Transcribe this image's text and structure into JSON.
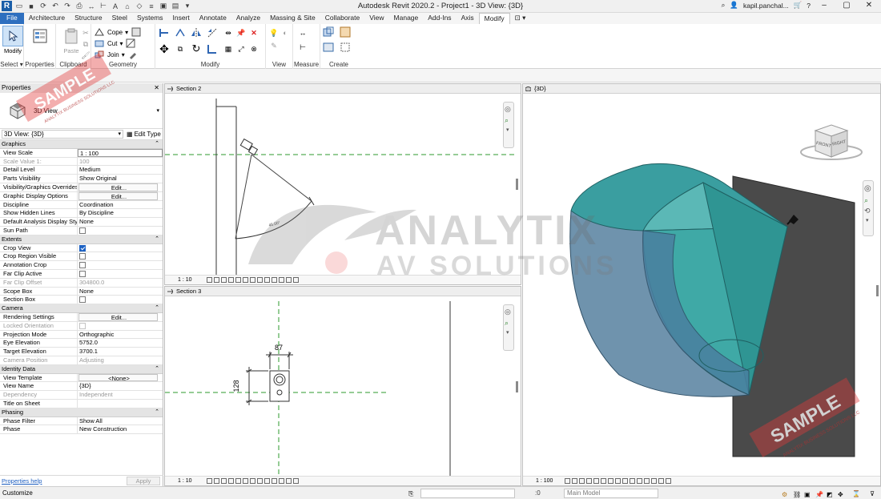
{
  "app": {
    "title": "Autodesk Revit 2020.2 - Project1 - 3D View: {3D}",
    "user": "kapil.panchal...",
    "logo_letter": "R"
  },
  "tabs": [
    {
      "label": "File"
    },
    {
      "label": "Architecture"
    },
    {
      "label": "Structure"
    },
    {
      "label": "Steel"
    },
    {
      "label": "Systems"
    },
    {
      "label": "Insert"
    },
    {
      "label": "Annotate"
    },
    {
      "label": "Analyze"
    },
    {
      "label": "Massing & Site"
    },
    {
      "label": "Collaborate"
    },
    {
      "label": "View"
    },
    {
      "label": "Manage"
    },
    {
      "label": "Add-Ins"
    },
    {
      "label": "Axis"
    },
    {
      "label": "Modify"
    }
  ],
  "ribbon": {
    "select": {
      "modify_label": "Modify",
      "panel_label": "Select"
    },
    "properties": {
      "panel_label": "Properties"
    },
    "clipboard": {
      "paste_label": "Paste",
      "panel_label": "Clipboard"
    },
    "geometry": {
      "cope_label": "Cope",
      "cut_label": "Cut",
      "join_label": "Join",
      "panel_label": "Geometry"
    },
    "modify": {
      "panel_label": "Modify"
    },
    "view": {
      "panel_label": "View"
    },
    "measure": {
      "panel_label": "Measure"
    },
    "create": {
      "panel_label": "Create"
    }
  },
  "properties": {
    "palette_title": "Properties",
    "type_name": "3D View",
    "instance_selector": "3D View: {3D}",
    "edit_type": "Edit Type",
    "groups": {
      "graphics": "Graphics",
      "extents": "Extents",
      "camera": "Camera",
      "identity": "Identity Data",
      "phasing": "Phasing"
    },
    "rows": {
      "view_scale": {
        "name": "View Scale",
        "value": "1 : 100"
      },
      "scale_value": {
        "name": "Scale Value  1:",
        "value": "100"
      },
      "detail_level": {
        "name": "Detail Level",
        "value": "Medium"
      },
      "parts_visibility": {
        "name": "Parts Visibility",
        "value": "Show Original"
      },
      "vg_overrides": {
        "name": "Visibility/Graphics Overrides",
        "value": "Edit..."
      },
      "graphic_display": {
        "name": "Graphic Display Options",
        "value": "Edit..."
      },
      "discipline": {
        "name": "Discipline",
        "value": "Coordination"
      },
      "hidden_lines": {
        "name": "Show Hidden Lines",
        "value": "By Discipline"
      },
      "analysis_style": {
        "name": "Default Analysis Display Style",
        "value": "None"
      },
      "sun_path": {
        "name": "Sun Path"
      },
      "crop_view": {
        "name": "Crop View"
      },
      "crop_region_visible": {
        "name": "Crop Region Visible"
      },
      "annotation_crop": {
        "name": "Annotation Crop"
      },
      "far_clip_active": {
        "name": "Far Clip Active"
      },
      "far_clip_offset": {
        "name": "Far Clip Offset",
        "value": "304800.0"
      },
      "scope_box": {
        "name": "Scope Box",
        "value": "None"
      },
      "section_box": {
        "name": "Section Box"
      },
      "rendering_settings": {
        "name": "Rendering Settings",
        "value": "Edit..."
      },
      "locked_orientation": {
        "name": "Locked Orientation"
      },
      "projection_mode": {
        "name": "Projection Mode",
        "value": "Orthographic"
      },
      "eye_elevation": {
        "name": "Eye Elevation",
        "value": "5752.0"
      },
      "target_elevation": {
        "name": "Target Elevation",
        "value": "3700.1"
      },
      "camera_position": {
        "name": "Camera Position",
        "value": "Adjusting"
      },
      "view_template": {
        "name": "View Template",
        "value": "<None>"
      },
      "view_name": {
        "name": "View Name",
        "value": "{3D}"
      },
      "dependency": {
        "name": "Dependency",
        "value": "Independent"
      },
      "title_on_sheet": {
        "name": "Title on Sheet",
        "value": ""
      },
      "phase_filter": {
        "name": "Phase Filter",
        "value": "Show All"
      },
      "phase": {
        "name": "Phase",
        "value": "New Construction"
      }
    },
    "checkboxes": {
      "sun_path": false,
      "crop_view": true,
      "crop_region_visible": false,
      "annotation_crop": false,
      "far_clip_active": false,
      "section_box": false,
      "locked_orientation": false
    },
    "help_link": "Properties help",
    "apply_button": "Apply"
  },
  "views": {
    "section2": {
      "title": "Section 2",
      "scale": "1 : 10"
    },
    "section3": {
      "title": "Section 3",
      "scale": "1 : 10",
      "dim_width": "87",
      "dim_height": "128"
    },
    "view3d": {
      "title": "{3D}",
      "scale": "1 : 100",
      "viewcube_front": "FRONT",
      "viewcube_right": "RIGHT"
    }
  },
  "statusbar": {
    "message": "Customize",
    "zero": ":0",
    "model": "Main Model"
  },
  "watermarks": {
    "sample": "SAMPLE",
    "company": "ANALYTIX BUSINESS SOLUTIONS LLC",
    "brand_line1": "ANALYTIX",
    "brand_line2": "AV SOLUTIONS"
  },
  "colors": {
    "file_tab": "#2e6fbf",
    "teal_fill": "#3a9ea0",
    "teal_light": "#5bb8b6",
    "blue_grey": "#6f93ad",
    "wall_dark": "#4a4a4a",
    "sample_red": "#e23a3a"
  }
}
